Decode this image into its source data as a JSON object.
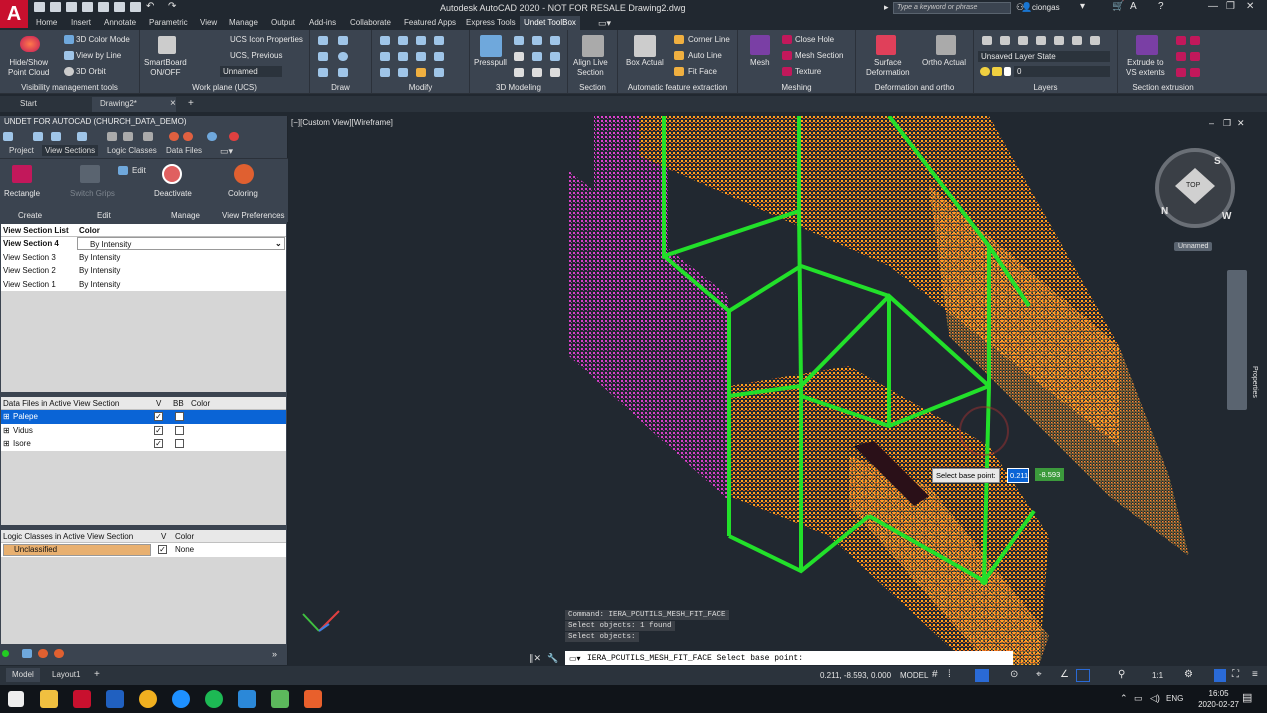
{
  "app": {
    "title": "Autodesk AutoCAD 2020 - NOT FOR RESALE   Drawing2.dwg",
    "search_placeholder": "Type a keyword or phrase",
    "user": "ciongas"
  },
  "menu": [
    "Home",
    "Insert",
    "Annotate",
    "Parametric",
    "View",
    "Manage",
    "Output",
    "Add-ins",
    "Collaborate",
    "Featured Apps",
    "Express Tools",
    "Undet ToolBox"
  ],
  "ribbon": {
    "vis": {
      "big": "Hide/Show\nPoint Cloud",
      "items": [
        "3D Color Mode",
        "View by Line",
        "3D Orbit"
      ],
      "label": "Visibility management tools"
    },
    "wp": {
      "big": "SmartBoard\nON/OFF",
      "items": [
        "UCS Icon Properties",
        "UCS, Previous",
        "Unnamed"
      ],
      "label": "Work plane (UCS)"
    },
    "draw": "Draw",
    "modify": "Modify",
    "model": {
      "big": "Presspull",
      "label": "3D Modeling"
    },
    "section": {
      "big": "Align Live\nSection",
      "label": "Section"
    },
    "afe": {
      "big": "Box Actual",
      "items": [
        "Corner Line",
        "Auto Line",
        "Fit Face"
      ],
      "label": "Automatic feature extraction"
    },
    "mesh": {
      "big": "Mesh",
      "items": [
        "Close Hole",
        "Mesh Section",
        "Texture"
      ],
      "label": "Meshing"
    },
    "def": {
      "big1": "Surface\nDeformation",
      "big2": "Ortho Actual",
      "label": "Deformation and ortho"
    },
    "layers": {
      "state": "Unsaved Layer State",
      "layer": "0",
      "label": "Layers"
    },
    "ext": {
      "big": "Extrude to\nVS extents",
      "label": "Section extrusion"
    }
  },
  "doctabs": [
    "Start",
    "Drawing2*"
  ],
  "palette": {
    "title": "UNDET FOR AUTOCAD (CHURCH_DATA_DEMO)",
    "tabs": [
      "Project",
      "View Sections",
      "Logic Classes",
      "Data Files"
    ],
    "btns": {
      "rect": "Rectangle",
      "switch": "Switch Grips",
      "edit": "Edit",
      "deact": "Deactivate",
      "color": "Coloring"
    },
    "groups": [
      "Create",
      "Edit",
      "Manage",
      "View Preferences"
    ],
    "vs_hdr": [
      "View Section List",
      "Color"
    ],
    "vs_rows": [
      [
        "View Section 4",
        "By Intensity"
      ],
      [
        "View Section 3",
        "By Intensity"
      ],
      [
        "View Section 2",
        "By Intensity"
      ],
      [
        "View Section 1",
        "By Intensity"
      ]
    ],
    "df_hdr": [
      "Data Files in Active View Section",
      "V",
      "BB",
      "Color"
    ],
    "df_rows": [
      "Palepe",
      "Vidus",
      "Isore"
    ],
    "lc_hdr": [
      "Logic Classes in Active View Section",
      "V",
      "Color"
    ],
    "lc_rows": [
      [
        "Unclassified",
        "None"
      ]
    ]
  },
  "viewport": {
    "label": "[−][Custom View][Wireframe]",
    "compass": [
      "S",
      "W",
      "N",
      "TOP"
    ],
    "unnamed": "Unnamed",
    "tooltip": "Select base point:",
    "dyn_x": "0.211",
    "dyn_y": "-8.593",
    "properties": "Properties"
  },
  "cmd": {
    "history": [
      "Command: IERA_PCUTILS_MESH_FIT_FACE",
      "Select objects: 1 found",
      "Select objects:"
    ],
    "prompt": "IERA_PCUTILS_MESH_FIT_FACE Select base point:"
  },
  "status": {
    "tabs": [
      "Model",
      "Layout1"
    ],
    "coords": "0.211, -8.593, 0.000",
    "model": "MODEL",
    "scale": "1:1"
  },
  "taskbar": {
    "lang": "ENG",
    "time": "16:05",
    "date": "2020-02-27"
  },
  "colors": {
    "pink": "#e040d0",
    "orange": "#ff9a20",
    "green": "#22e02a",
    "ribbon": "#3b4450",
    "bg": "#212830"
  }
}
